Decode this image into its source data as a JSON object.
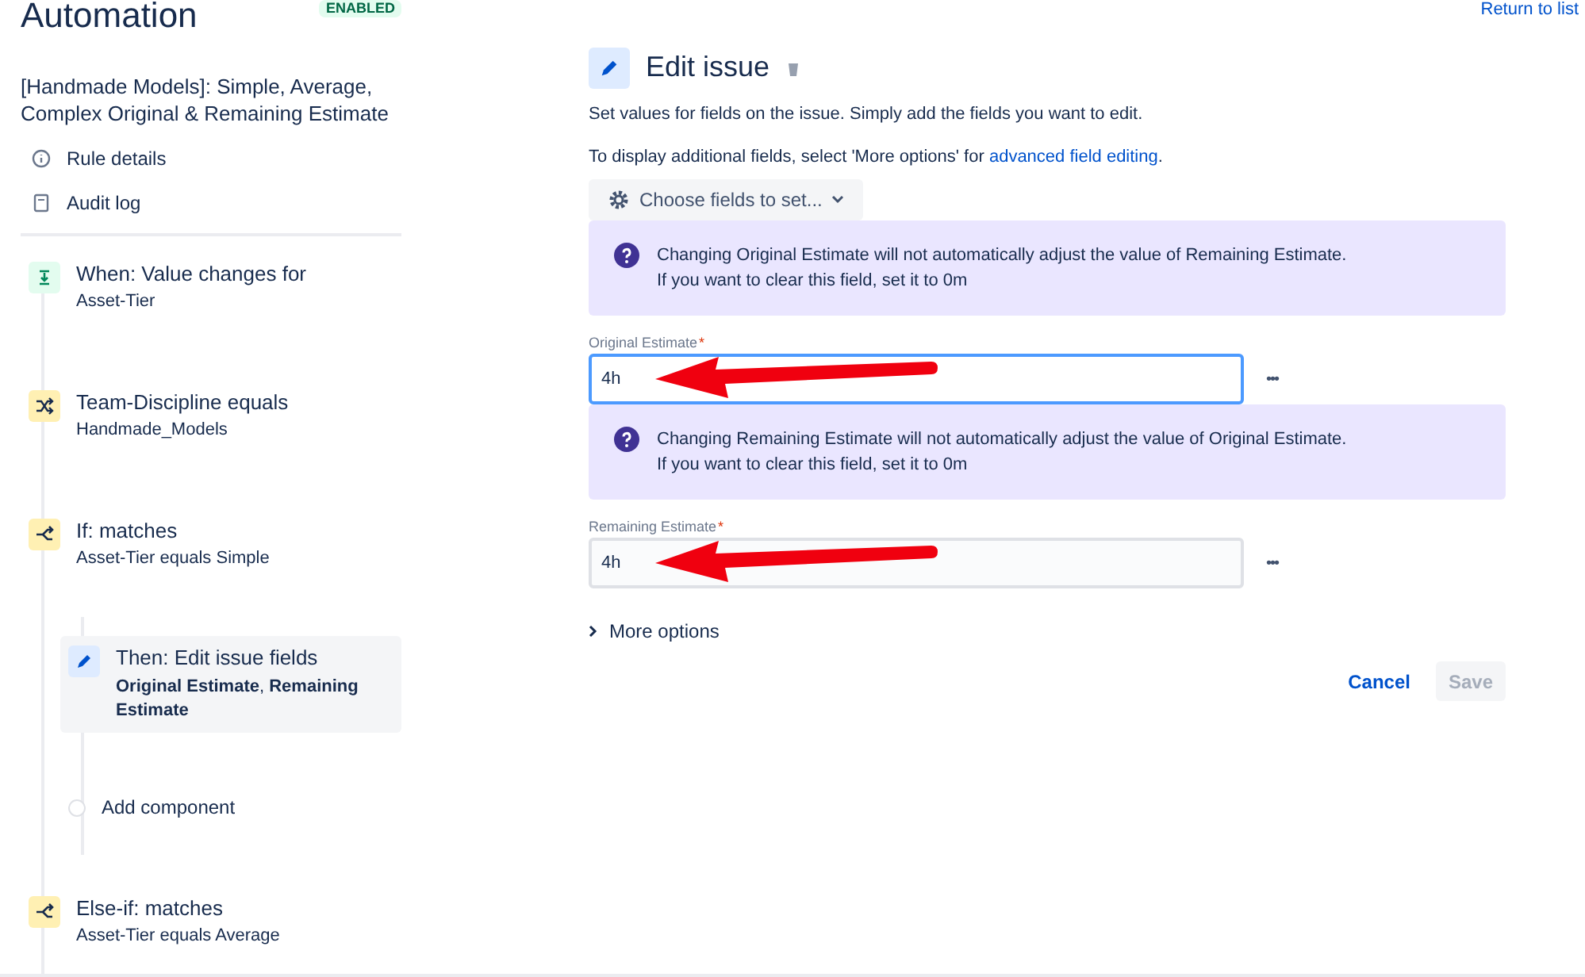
{
  "header": {
    "title": "Automation",
    "status_badge": "ENABLED",
    "return_link": "Return to list"
  },
  "sidebar": {
    "rule_name": "[Handmade Models]: Simple, Average, Complex Original & Remaining Estimate",
    "links": [
      {
        "kind": "info",
        "label": "Rule details"
      },
      {
        "kind": "log",
        "label": "Audit log"
      }
    ],
    "steps": [
      {
        "kind": "trigger",
        "title": "When: Value changes for",
        "detail": "Asset-Tier",
        "selected": false
      },
      {
        "kind": "condition",
        "title": "Team-Discipline equals",
        "detail": "Handmade_Models",
        "selected": false
      },
      {
        "kind": "branch",
        "title": "If: matches",
        "detail": "Asset-Tier equals Simple",
        "selected": false,
        "children": [
          {
            "kind": "action",
            "title": "Then: Edit issue fields",
            "detail": "**Original Estimate**, **Remaining Estimate**",
            "selected": true
          },
          {
            "kind": "add",
            "title": "Add component",
            "selected": false
          }
        ]
      },
      {
        "kind": "branch",
        "title": "Else-if: matches",
        "detail": "Asset-Tier equals Average",
        "selected": false
      }
    ]
  },
  "panel": {
    "title": "Edit issue",
    "description": "Set values for fields on the issue. Simply add the fields you want to edit.",
    "hint": "To display additional fields, select 'More options' for ",
    "hint_link": "advanced field editing",
    "hint_end": ".",
    "choose_button": "Choose fields to set...",
    "sections": [
      {
        "notice": [
          "Changing Original Estimate will not automatically adjust the value of Remaining Estimate.",
          "If you want to clear this field, set it to 0m"
        ],
        "label": "Original Estimate",
        "required_mark": "*",
        "value": "4h",
        "focused": true,
        "arrow": true,
        "more": "•••"
      },
      {
        "notice": [
          "Changing Remaining Estimate will not automatically adjust the value of Original Estimate.",
          "If you want to clear this field, set it to 0m"
        ],
        "label": "Remaining Estimate",
        "required_mark": "*",
        "value": "4h",
        "focused": false,
        "arrow": true,
        "more": "•••"
      }
    ],
    "more_options": "More options",
    "cancel": "Cancel",
    "save": "Save",
    "save_disabled": true
  }
}
